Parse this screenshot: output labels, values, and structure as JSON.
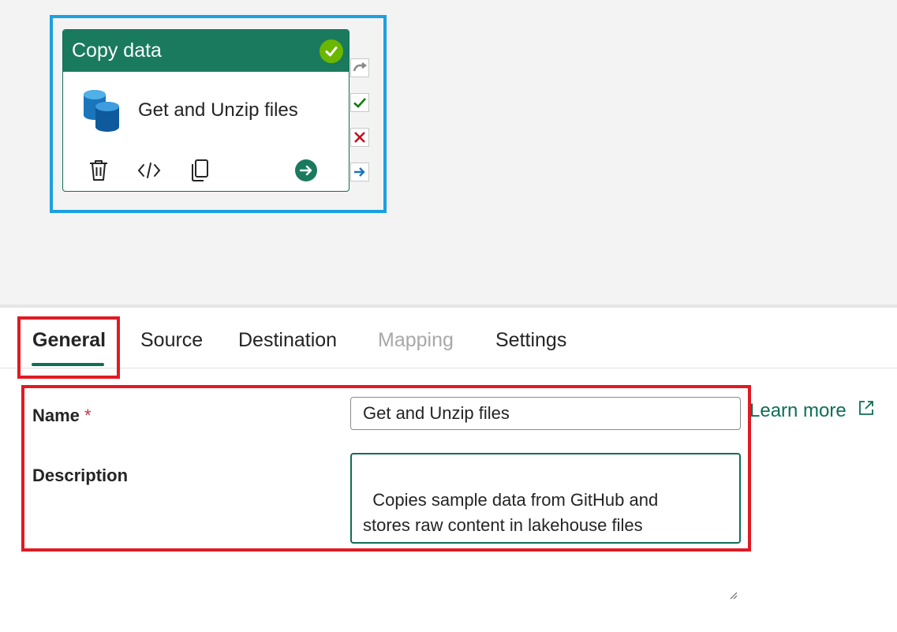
{
  "activity": {
    "type_label": "Copy data",
    "name": "Get and Unzip files",
    "status": "succeeded",
    "header_color": "#1a7a5e",
    "actions": [
      "delete-icon",
      "code-icon",
      "copy-icon",
      "arrow-right-icon"
    ],
    "connectors": [
      "skip-icon",
      "success-icon",
      "failure-icon",
      "completion-icon"
    ]
  },
  "tabs": [
    {
      "label": "General",
      "state": "active"
    },
    {
      "label": "Source",
      "state": "normal"
    },
    {
      "label": "Destination",
      "state": "normal"
    },
    {
      "label": "Mapping",
      "state": "disabled"
    },
    {
      "label": "Settings",
      "state": "normal"
    }
  ],
  "form": {
    "name_label": "Name",
    "required_marker": "*",
    "name_value": "Get and Unzip files",
    "description_label": "Description",
    "description_value": "Copies sample data from GitHub and\nstores raw content in lakehouse files",
    "learn_more": "Learn more"
  },
  "colors": {
    "accent": "#0f6e56",
    "highlight_blue": "#1aa1e0",
    "annotation_red": "#e11a22"
  }
}
